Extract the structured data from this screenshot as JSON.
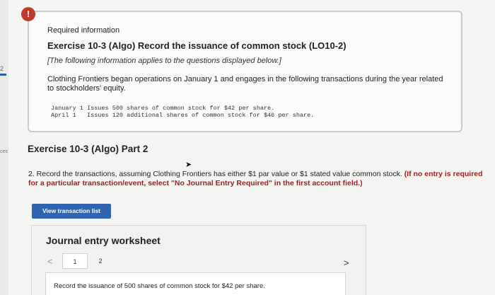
{
  "left_strip": {
    "number": "2",
    "text": "ces"
  },
  "info": {
    "alert_symbol": "!",
    "heading": "Required information",
    "exercise_title": "Exercise 10-3 (Algo) Record the issuance of common stock (LO10-2)",
    "note": "[The following information applies to the questions displayed below.]",
    "description": "Clothing Frontiers began operations on January 1 and engages in the following transactions during the year related to stockholders' equity.",
    "transactions": [
      "January 1 Issues 500 shares of common stock for $42 per share.",
      "April 1   Issues 120 additional shares of common stock for $46 per share."
    ]
  },
  "part": {
    "title": "Exercise 10-3 (Algo) Part 2",
    "question_text": "2. Record the transactions, assuming Clothing Frontiers has either $1 par value or $1 stated value common stock. ",
    "question_bold": "(If no entry is required for a particular transaction/event, select \"No Journal Entry Required\" in the first account field.)"
  },
  "buttons": {
    "view_transactions": "View transaction list"
  },
  "worksheet": {
    "title": "Journal entry worksheet",
    "prev_symbol": "<",
    "next_symbol": ">",
    "pages": [
      "1",
      "2"
    ],
    "current_page": "1",
    "entry_description": "Record the issuance of 500 shares of common stock for $42 per share."
  },
  "icons": {
    "alert": "alert-icon",
    "prev": "chevron-left-icon",
    "next": "chevron-right-icon",
    "cursor": "cursor-icon"
  },
  "colors": {
    "alert": "#c0392b",
    "button": "#2e64b0",
    "instruction_bold": "#a32020"
  }
}
